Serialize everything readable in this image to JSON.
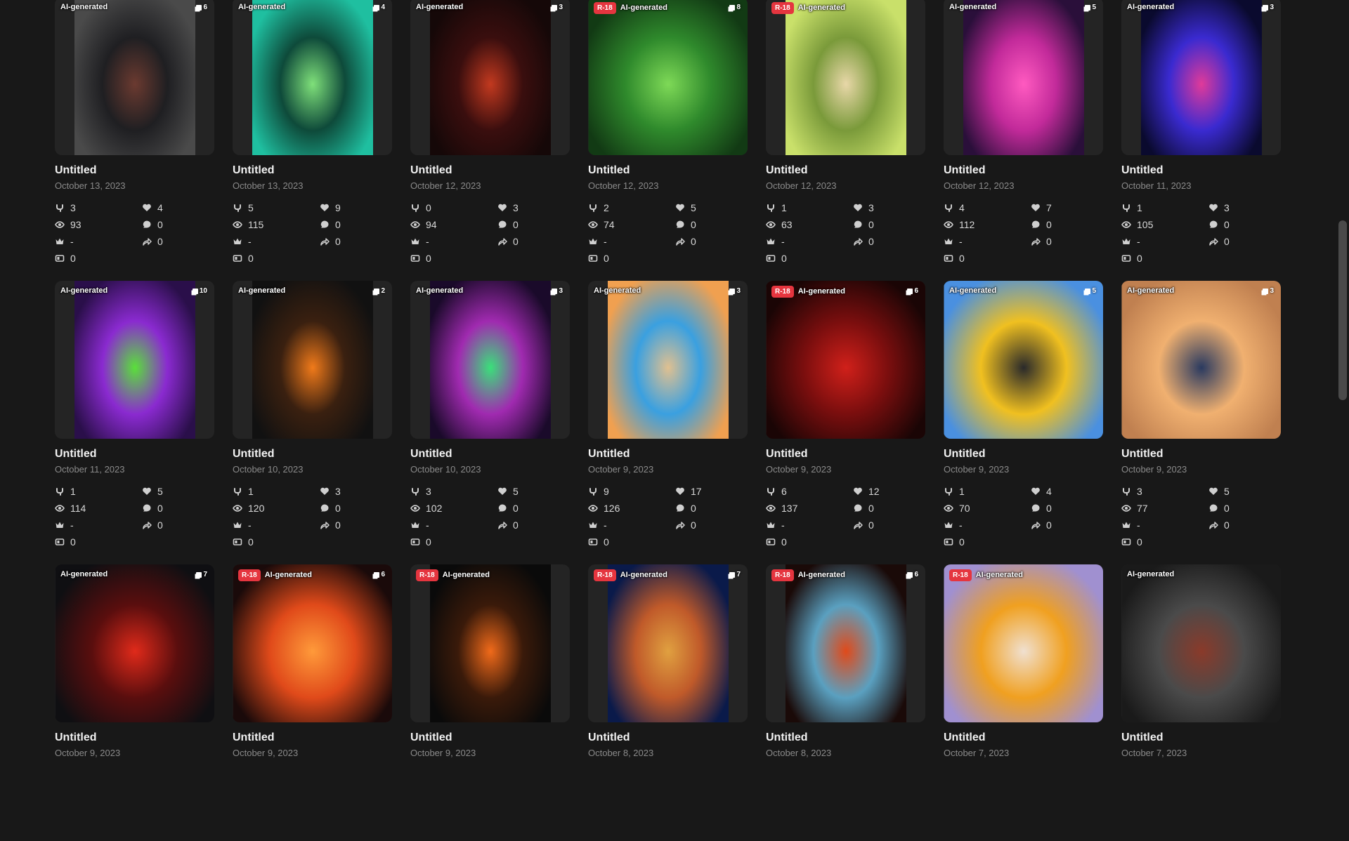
{
  "badge_ai": "AI-generated",
  "badge_r18": "R-18",
  "cards": [
    {
      "title": "Untitled",
      "date": "October 13, 2023",
      "pages": "6",
      "r18": false,
      "colors": [
        "#4a4a4a",
        "#1f1f22",
        "#6b3a30"
      ],
      "full": false,
      "stats": {
        "remixes": "3",
        "likes": "4",
        "views": "93",
        "comments": "0",
        "crown": "-",
        "shares": "0",
        "collections": "0"
      }
    },
    {
      "title": "Untitled",
      "date": "October 13, 2023",
      "pages": "4",
      "r18": false,
      "colors": [
        "#1fbfa0",
        "#0e4a3a",
        "#7fe07a"
      ],
      "full": false,
      "stats": {
        "remixes": "5",
        "likes": "9",
        "views": "115",
        "comments": "0",
        "crown": "-",
        "shares": "0",
        "collections": "0"
      }
    },
    {
      "title": "Untitled",
      "date": "October 12, 2023",
      "pages": "3",
      "r18": false,
      "colors": [
        "#150808",
        "#3a0e0e",
        "#c2391f"
      ],
      "full": false,
      "stats": {
        "remixes": "0",
        "likes": "3",
        "views": "94",
        "comments": "0",
        "crown": "-",
        "shares": "0",
        "collections": "0"
      }
    },
    {
      "title": "Untitled",
      "date": "October 12, 2023",
      "pages": "8",
      "r18": true,
      "colors": [
        "#123a14",
        "#2f8a2c",
        "#7ed957"
      ],
      "full": true,
      "stats": {
        "remixes": "2",
        "likes": "5",
        "views": "74",
        "comments": "0",
        "crown": "-",
        "shares": "0",
        "collections": "0"
      }
    },
    {
      "title": "Untitled",
      "date": "October 12, 2023",
      "pages": "",
      "r18": true,
      "colors": [
        "#c9e06a",
        "#7a9a3a",
        "#e8d7a8"
      ],
      "full": false,
      "stats": {
        "remixes": "1",
        "likes": "3",
        "views": "63",
        "comments": "0",
        "crown": "-",
        "shares": "0",
        "collections": "0"
      }
    },
    {
      "title": "Untitled",
      "date": "October 12, 2023",
      "pages": "5",
      "r18": false,
      "colors": [
        "#2a0f3a",
        "#c22a9a",
        "#ff5ac0"
      ],
      "full": false,
      "stats": {
        "remixes": "4",
        "likes": "7",
        "views": "112",
        "comments": "0",
        "crown": "-",
        "shares": "0",
        "collections": "0"
      }
    },
    {
      "title": "Untitled",
      "date": "October 11, 2023",
      "pages": "3",
      "r18": false,
      "colors": [
        "#0a0a2e",
        "#3a2ad0",
        "#e03a9a"
      ],
      "full": false,
      "stats": {
        "remixes": "1",
        "likes": "3",
        "views": "105",
        "comments": "0",
        "crown": "-",
        "shares": "0",
        "collections": "0"
      }
    },
    {
      "title": "Untitled",
      "date": "October 11, 2023",
      "pages": "10",
      "r18": false,
      "colors": [
        "#2a0f4a",
        "#8a2ad0",
        "#5ae03a"
      ],
      "full": false,
      "stats": {
        "remixes": "1",
        "likes": "5",
        "views": "114",
        "comments": "0",
        "crown": "-",
        "shares": "0",
        "collections": "0"
      }
    },
    {
      "title": "Untitled",
      "date": "October 10, 2023",
      "pages": "2",
      "r18": false,
      "colors": [
        "#111",
        "#3a2010",
        "#f07a1a"
      ],
      "full": false,
      "stats": {
        "remixes": "1",
        "likes": "3",
        "views": "120",
        "comments": "0",
        "crown": "-",
        "shares": "0",
        "collections": "0"
      }
    },
    {
      "title": "Untitled",
      "date": "October 10, 2023",
      "pages": "3",
      "r18": false,
      "colors": [
        "#1a0a2a",
        "#a02ab0",
        "#3ae07a"
      ],
      "full": false,
      "stats": {
        "remixes": "3",
        "likes": "5",
        "views": "102",
        "comments": "0",
        "crown": "-",
        "shares": "0",
        "collections": "0"
      }
    },
    {
      "title": "Untitled",
      "date": "October 9, 2023",
      "pages": "3",
      "r18": false,
      "colors": [
        "#f0a050",
        "#3aa0e0",
        "#e0c090"
      ],
      "full": false,
      "stats": {
        "remixes": "9",
        "likes": "17",
        "views": "126",
        "comments": "0",
        "crown": "-",
        "shares": "0",
        "collections": "0"
      }
    },
    {
      "title": "Untitled",
      "date": "October 9, 2023",
      "pages": "6",
      "r18": true,
      "colors": [
        "#1a0505",
        "#7a0e0e",
        "#d0201a"
      ],
      "full": true,
      "stats": {
        "remixes": "6",
        "likes": "12",
        "views": "137",
        "comments": "0",
        "crown": "-",
        "shares": "0",
        "collections": "0"
      }
    },
    {
      "title": "Untitled",
      "date": "October 9, 2023",
      "pages": "5",
      "r18": false,
      "colors": [
        "#4a90e0",
        "#f0c020",
        "#2a2a2a"
      ],
      "full": true,
      "stats": {
        "remixes": "1",
        "likes": "4",
        "views": "70",
        "comments": "0",
        "crown": "-",
        "shares": "0",
        "collections": "0"
      }
    },
    {
      "title": "Untitled",
      "date": "October 9, 2023",
      "pages": "3",
      "r18": false,
      "colors": [
        "#c08050",
        "#f0b070",
        "#2a3a60"
      ],
      "full": true,
      "stats": {
        "remixes": "3",
        "likes": "5",
        "views": "77",
        "comments": "0",
        "crown": "-",
        "shares": "0",
        "collections": "0"
      }
    },
    {
      "title": "Untitled",
      "date": "October 9, 2023",
      "pages": "7",
      "r18": false,
      "colors": [
        "#0f0f12",
        "#5a0e0e",
        "#e02a1a"
      ],
      "full": true,
      "stats": {
        "remixes": "",
        "likes": "",
        "views": "",
        "comments": "",
        "crown": "",
        "shares": "",
        "collections": ""
      }
    },
    {
      "title": "Untitled",
      "date": "October 9, 2023",
      "pages": "6",
      "r18": true,
      "colors": [
        "#1a0a0a",
        "#e04a1a",
        "#ff9a3a"
      ],
      "full": true,
      "stats": {
        "remixes": "",
        "likes": "",
        "views": "",
        "comments": "",
        "crown": "",
        "shares": "",
        "collections": ""
      }
    },
    {
      "title": "Untitled",
      "date": "October 9, 2023",
      "pages": "",
      "r18": true,
      "colors": [
        "#0a0a0a",
        "#3a1a0a",
        "#f06a1a"
      ],
      "full": false,
      "stats": {
        "remixes": "",
        "likes": "",
        "views": "",
        "comments": "",
        "crown": "",
        "shares": "",
        "collections": ""
      }
    },
    {
      "title": "Untitled",
      "date": "October 8, 2023",
      "pages": "7",
      "r18": true,
      "colors": [
        "#0a1a4a",
        "#c05a2a",
        "#e0a040"
      ],
      "full": false,
      "stats": {
        "remixes": "",
        "likes": "",
        "views": "",
        "comments": "",
        "crown": "",
        "shares": "",
        "collections": ""
      }
    },
    {
      "title": "Untitled",
      "date": "October 8, 2023",
      "pages": "6",
      "r18": true,
      "colors": [
        "#1a0a08",
        "#5aa0c0",
        "#e04a1a"
      ],
      "full": false,
      "stats": {
        "remixes": "",
        "likes": "",
        "views": "",
        "comments": "",
        "crown": "",
        "shares": "",
        "collections": ""
      }
    },
    {
      "title": "Untitled",
      "date": "October 7, 2023",
      "pages": "",
      "r18": true,
      "colors": [
        "#a090d0",
        "#f0a020",
        "#f0e0d0"
      ],
      "full": true,
      "stats": {
        "remixes": "",
        "likes": "",
        "views": "",
        "comments": "",
        "crown": "",
        "shares": "",
        "collections": ""
      }
    },
    {
      "title": "Untitled",
      "date": "October 7, 2023",
      "pages": "",
      "r18": false,
      "colors": [
        "#1a1a1a",
        "#4a4a4a",
        "#8a3a2a"
      ],
      "full": true,
      "stats": {
        "remixes": "",
        "likes": "",
        "views": "",
        "comments": "",
        "crown": "",
        "shares": "",
        "collections": ""
      }
    }
  ],
  "icons": {
    "remixes": "remix-icon",
    "likes": "heart-icon",
    "views": "eye-icon",
    "comments": "comment-icon",
    "crown": "crown-icon",
    "shares": "share-icon",
    "collections": "collection-icon",
    "pages": "pages-icon"
  }
}
